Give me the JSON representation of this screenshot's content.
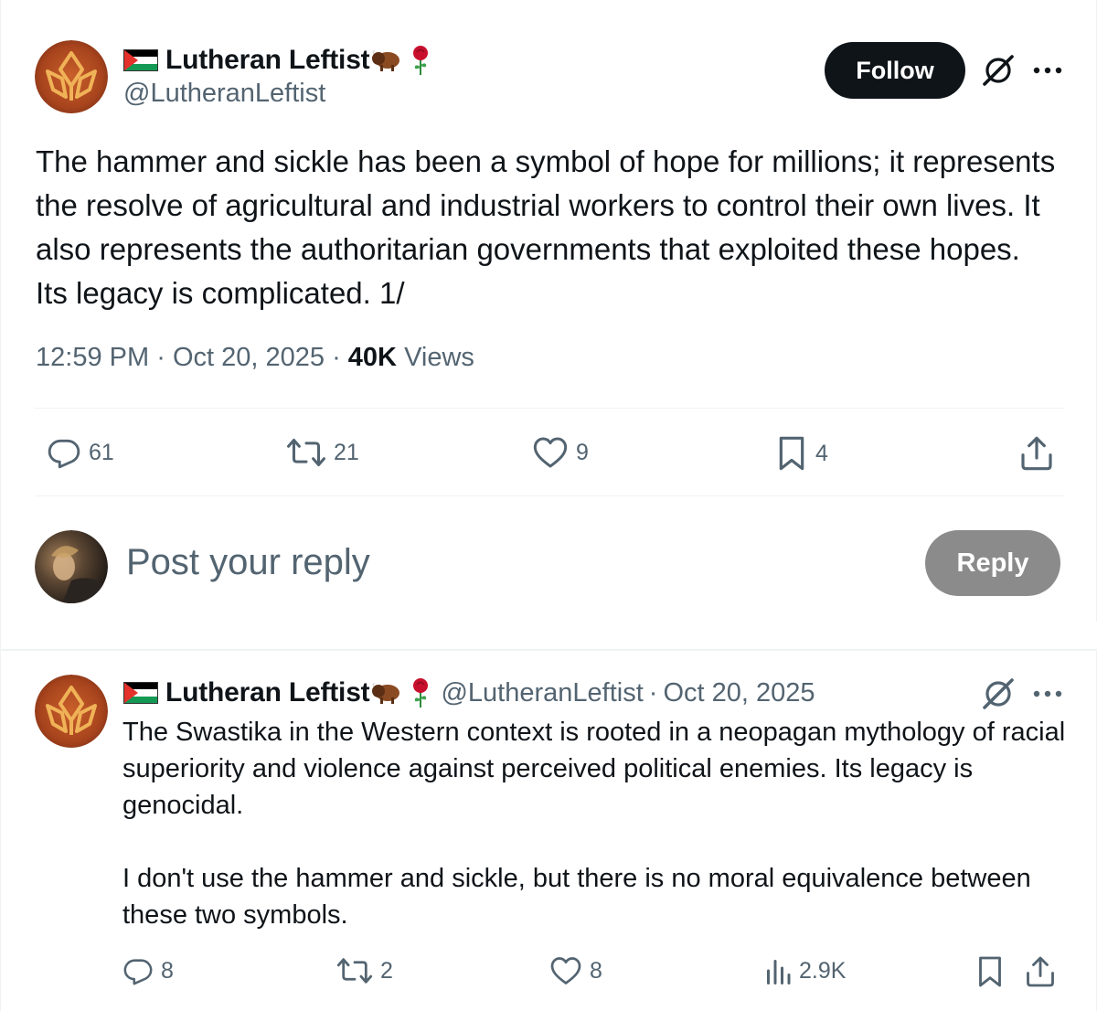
{
  "main_post": {
    "author": {
      "display_name": "Lutheran Leftist",
      "handle": "@LutheranLeftist",
      "name_emojis": [
        "palestine-flag",
        "bison",
        "rose"
      ]
    },
    "follow_label": "Follow",
    "text": "The hammer and sickle has been a symbol of hope for millions; it represents the resolve of agricultural and industrial workers to control their own lives. It also represents  the authoritarian governments that exploited these hopes. Its legacy is complicated. 1/",
    "time": "12:59 PM",
    "separator": "·",
    "date": "Oct 20, 2025",
    "views_count": "40K",
    "views_label": "Views",
    "stats": {
      "replies": "61",
      "reposts": "21",
      "likes": "9",
      "bookmarks": "4"
    }
  },
  "compose": {
    "placeholder": "Post your reply",
    "reply_label": "Reply"
  },
  "reply_post": {
    "author": {
      "display_name": "Lutheran Leftist",
      "handle": "@LutheranLeftist",
      "separator": "·",
      "date": "Oct 20, 2025"
    },
    "paragraphs": [
      "The Swastika in the Western context is rooted in a neopagan mythology of racial superiority and violence against perceived political enemies. Its legacy is genocidal.",
      "I don't use the hammer and sickle, but there is no moral equivalence between these two symbols."
    ],
    "stats": {
      "replies": "8",
      "reposts": "2",
      "likes": "8",
      "views": "2.9K"
    }
  },
  "colors": {
    "text_primary": "#0f1419",
    "text_secondary": "#536471",
    "follow_bg": "#0f1419",
    "reply_btn_bg": "#8b8b8b",
    "divider": "#eff3f4"
  }
}
